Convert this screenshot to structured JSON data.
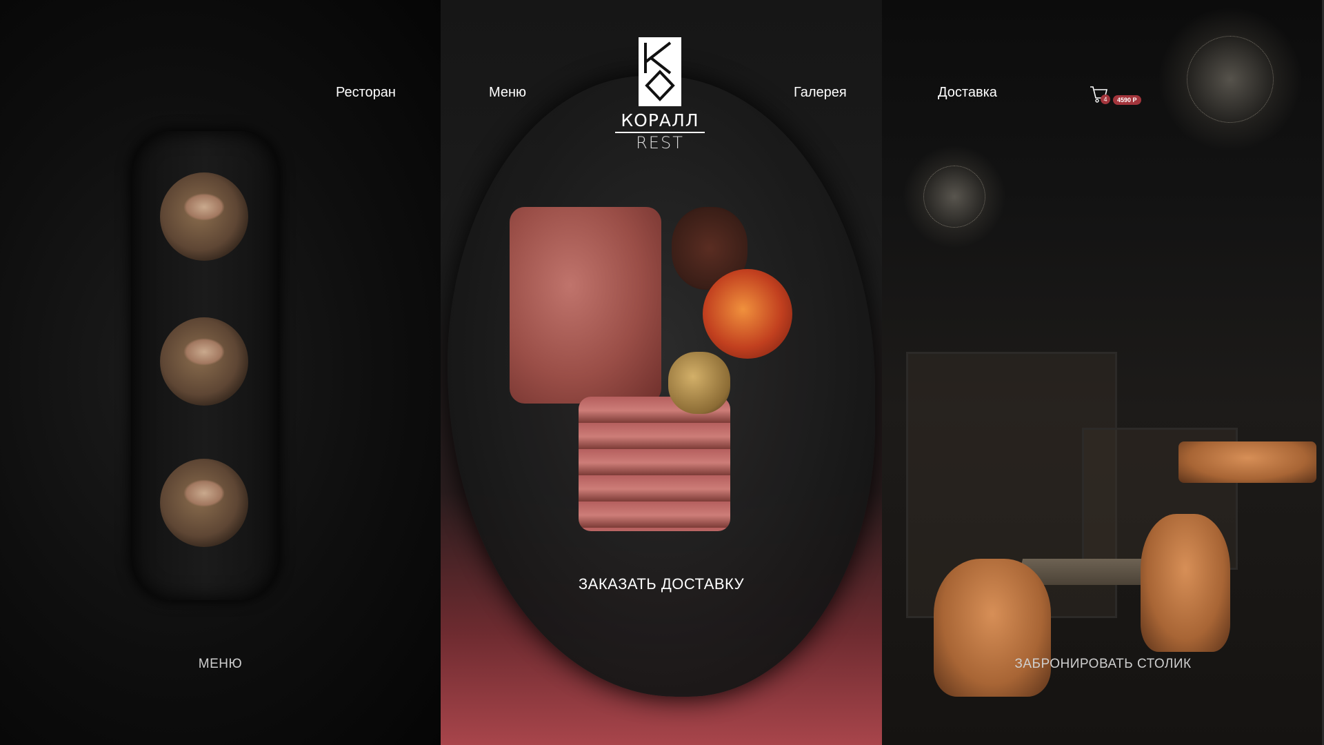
{
  "nav": {
    "restaurant": "Ресторан",
    "menu": "Меню",
    "gallery": "Галерея",
    "delivery": "Доставка"
  },
  "logo": {
    "name": "КОРАЛЛ",
    "sub": "REST"
  },
  "cart": {
    "count": "4",
    "total": "4590 Р"
  },
  "cta": {
    "menu": "МЕНЮ",
    "order_delivery": "ЗАКАЗАТЬ ДОСТАВКУ",
    "book_table": "ЗАБРОНИРОВАТЬ СТОЛИК"
  },
  "colors": {
    "accent": "#a3353c",
    "background": "#000000",
    "text": "#ffffff"
  },
  "icons": [
    "cart-icon",
    "logo-monogram-icon"
  ]
}
